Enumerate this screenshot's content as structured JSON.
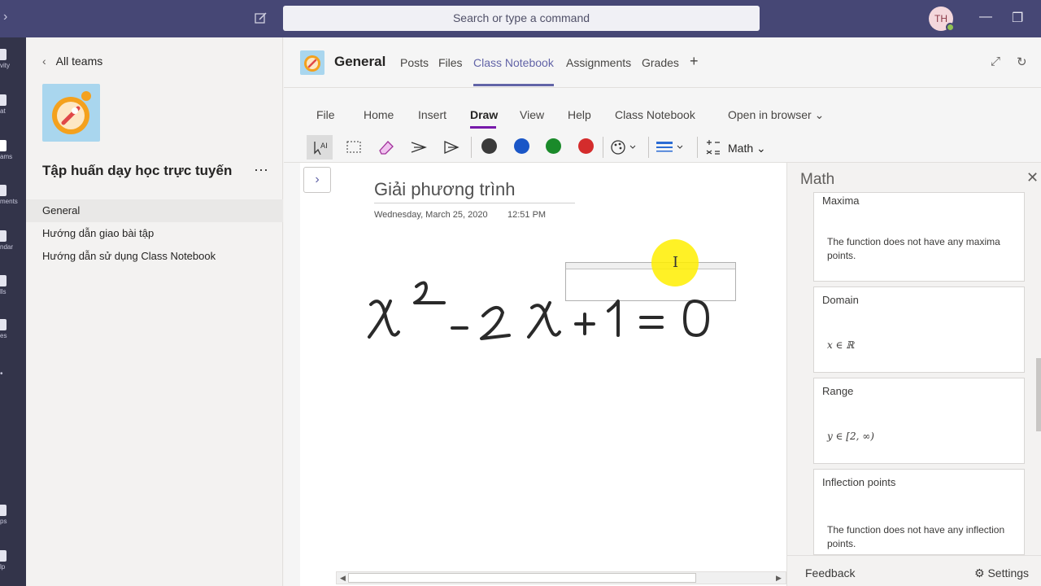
{
  "topbar": {
    "search_placeholder": "Search or type a command",
    "avatar_initials": "TH",
    "minimize_glyph": "—",
    "maximize_glyph": "❐"
  },
  "rail": {
    "items": [
      {
        "label": "vity",
        "icon": "bell-icon"
      },
      {
        "label": "at",
        "icon": "chat-icon"
      },
      {
        "label": "ams",
        "icon": "teams-icon"
      },
      {
        "label": "ments",
        "icon": "assignments-icon"
      },
      {
        "label": "ndar",
        "icon": "calendar-icon"
      },
      {
        "label": "lls",
        "icon": "calls-icon"
      },
      {
        "label": "es",
        "icon": "files-icon"
      },
      {
        "label": "•",
        "icon": "more-icon"
      },
      {
        "label": "ps",
        "icon": "apps-icon"
      },
      {
        "label": "lp",
        "icon": "help-icon"
      }
    ]
  },
  "team_panel": {
    "all_teams_label": "All teams",
    "team_name": "Tập huấn dạy học trực tuyến",
    "more_glyph": "···",
    "channels": [
      "General",
      "Hướng dẫn giao bài tập",
      "Hướng dẫn sử dụng Class Notebook"
    ]
  },
  "channel_header": {
    "title": "General",
    "tabs": [
      "Posts",
      "Files",
      "Class Notebook",
      "Assignments",
      "Grades"
    ],
    "active_tab": "Class Notebook",
    "add_tab_glyph": "+"
  },
  "ribbon": {
    "tabs": [
      "File",
      "Home",
      "Insert",
      "Draw",
      "View",
      "Help",
      "Class Notebook"
    ],
    "active_tab": "Draw",
    "open_in_browser": "Open in browser",
    "math_label": "Math",
    "pen_colors": [
      "#3a3a3a",
      "#1a56c7",
      "#1a8a2a",
      "#d42c2c"
    ],
    "accent_color": "#7719aa"
  },
  "page": {
    "title": "Giải phương trình",
    "date": "Wednesday, March 25, 2020",
    "time": "12:51 PM",
    "ink_equation": "x² - 2x + 1 = 0"
  },
  "math_pane": {
    "header": "Math",
    "cards": [
      {
        "title": "Maxima",
        "body": "The function does not have any maxima points."
      },
      {
        "title": "Domain",
        "math": "x ∈ ℝ"
      },
      {
        "title": "Range",
        "math": "y ∈ [2, ∞)"
      },
      {
        "title": "Inflection points",
        "body": "The function does not have any inflection points."
      }
    ],
    "feedback_label": "Feedback",
    "settings_label": "Settings"
  }
}
